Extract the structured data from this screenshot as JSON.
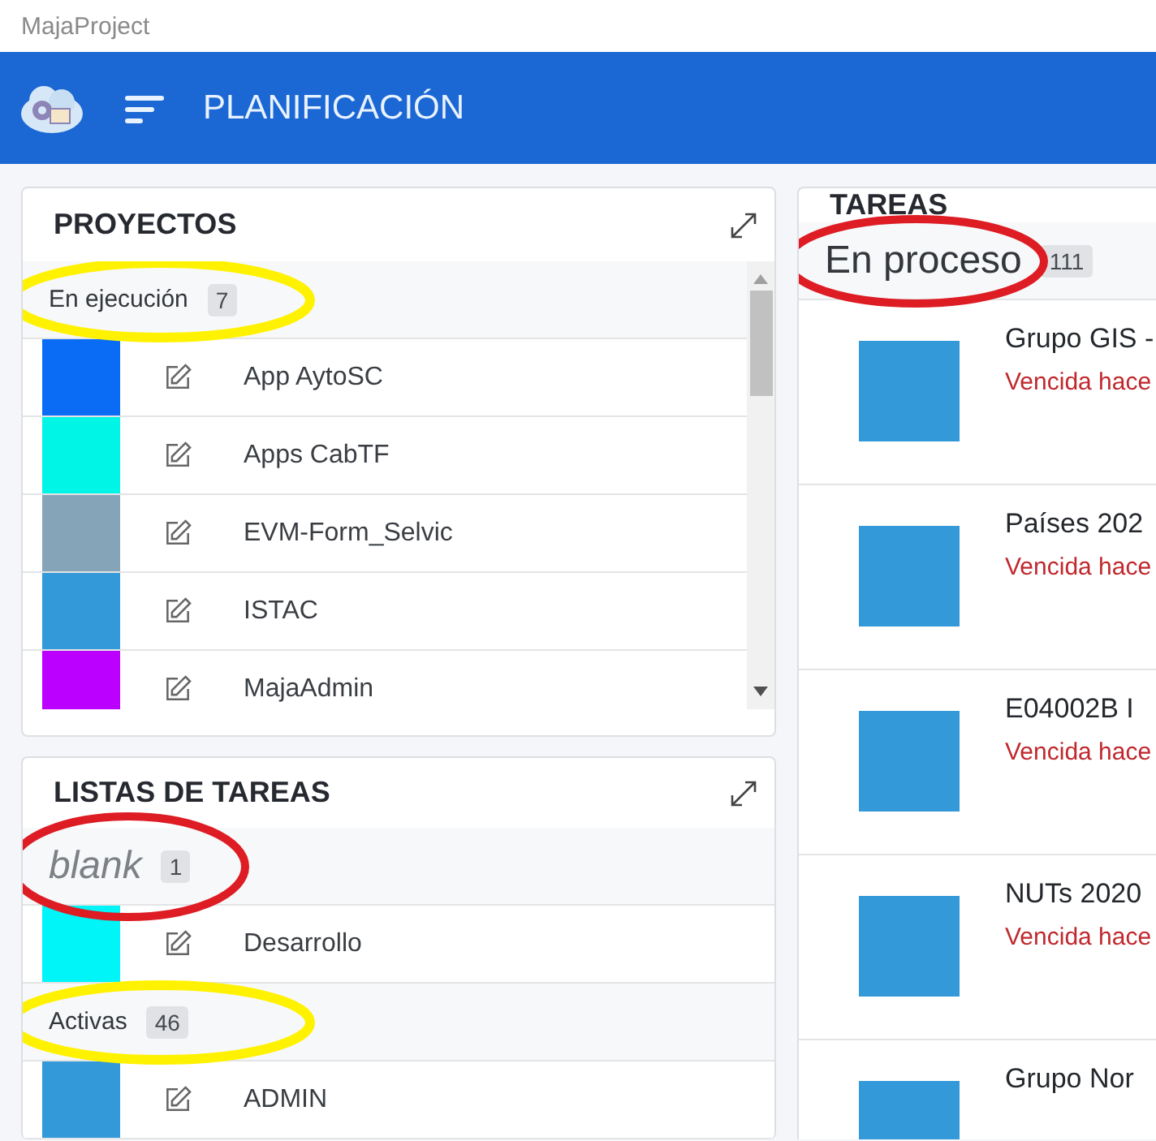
{
  "window": {
    "title": "MajaProject"
  },
  "header": {
    "title": "PLANIFICACIÓN"
  },
  "projects": {
    "title": "PROYECTOS",
    "groups": [
      {
        "label": "En ejecución",
        "count": "7",
        "kind": "normal",
        "color": "#fff200",
        "items": [
          {
            "name": "App AytoSC",
            "color": "#0a6cf5"
          },
          {
            "name": "Apps CabTF",
            "color": "#00f5e6"
          },
          {
            "name": "EVM-Form_Selvic",
            "color": "#85a4b8"
          },
          {
            "name": "ISTAC",
            "color": "#3399d9"
          },
          {
            "name": "MajaAdmin",
            "color": "#bb00ff"
          }
        ]
      }
    ]
  },
  "task_lists": {
    "title": "LISTAS DE TAREAS",
    "groups": [
      {
        "label": "blank",
        "count": "1",
        "kind": "placeholder",
        "color": "#dd1c24",
        "items": [
          {
            "name": "Desarrollo",
            "color": "#00f5f8"
          }
        ]
      },
      {
        "label": "Activas",
        "count": "46",
        "kind": "normal",
        "color": "#fff200",
        "items": [
          {
            "name": "ADMIN",
            "color": "#3399d9"
          }
        ]
      }
    ]
  },
  "tasks": {
    "title": "TAREAS",
    "group": {
      "label": "En proceso",
      "count": "111",
      "kind": "large",
      "color": "#dd1c24"
    },
    "items": [
      {
        "name": "Grupo GIS -",
        "status": "Vencida hace",
        "color": "#3399d9"
      },
      {
        "name": "Países 202",
        "status": "Vencida hace",
        "color": "#3399d9"
      },
      {
        "name": "E04002B I",
        "status": "Vencida hace",
        "color": "#3399d9"
      },
      {
        "name": "NUTs 2020",
        "status": "Vencida hace",
        "color": "#3399d9"
      },
      {
        "name": "Grupo Nor",
        "color": "#3399d9"
      }
    ]
  }
}
